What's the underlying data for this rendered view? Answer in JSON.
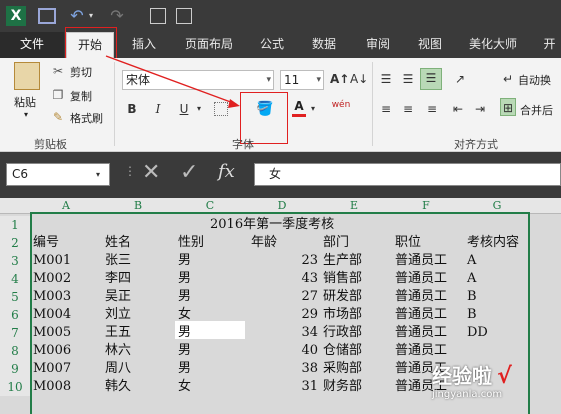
{
  "quick_access": {
    "logo": "X",
    "save_icon": "save-icon",
    "undo": "↶",
    "redo": "↷"
  },
  "tabs": [
    {
      "label": "文件",
      "kind": "file"
    },
    {
      "label": "开始",
      "kind": "active"
    },
    {
      "label": "插入"
    },
    {
      "label": "页面布局"
    },
    {
      "label": "公式"
    },
    {
      "label": "数据"
    },
    {
      "label": "审阅"
    },
    {
      "label": "视图"
    },
    {
      "label": "美化大师"
    },
    {
      "label": "开"
    }
  ],
  "ribbon": {
    "paste": "粘贴",
    "cut": "剪切",
    "copy": "复制",
    "format_painter": "格式刷",
    "clipboard_group": "剪贴板",
    "font_name": "宋体",
    "font_size": "11",
    "bold": "B",
    "italic": "I",
    "underline": "U",
    "font_group": "字体",
    "wrap": "自动换",
    "merge": "合并后",
    "align_group": "对齐方式",
    "font_color": "A",
    "wen": "wén"
  },
  "formula_bar": {
    "cell_ref": "C6",
    "fx": "fx",
    "value": "女"
  },
  "columns": [
    "A",
    "B",
    "C",
    "D",
    "E",
    "F",
    "G"
  ],
  "rows": [
    "1",
    "2",
    "3",
    "4",
    "5",
    "6",
    "7",
    "8",
    "9",
    "10"
  ],
  "sheet": {
    "title": "2016年第一季度考核",
    "headers": [
      "编号",
      "姓名",
      "性别",
      "年龄",
      "部门",
      "职位",
      "考核内容"
    ],
    "data": [
      [
        "M001",
        "张三",
        "男",
        "23",
        "生产部",
        "普通员工",
        "A"
      ],
      [
        "M002",
        "李四",
        "男",
        "43",
        "销售部",
        "普通员工",
        "A"
      ],
      [
        "M003",
        "吴正",
        "男",
        "27",
        "研发部",
        "普通员工",
        "B"
      ],
      [
        "M004",
        "刘立",
        "女",
        "29",
        "市场部",
        "普通员工",
        "B"
      ],
      [
        "M005",
        "王五",
        "男",
        "34",
        "行政部",
        "普通员工",
        "DD"
      ],
      [
        "M006",
        "林六",
        "男",
        "40",
        "仓储部",
        "普通员工",
        ""
      ],
      [
        "M007",
        "周八",
        "男",
        "38",
        "采购部",
        "普通员工",
        ""
      ],
      [
        "M008",
        "韩久",
        "女",
        "31",
        "财务部",
        "普通员工",
        ""
      ]
    ]
  },
  "watermark": {
    "text": "经验啦",
    "url": "jingyanla.com",
    "check": "√"
  }
}
